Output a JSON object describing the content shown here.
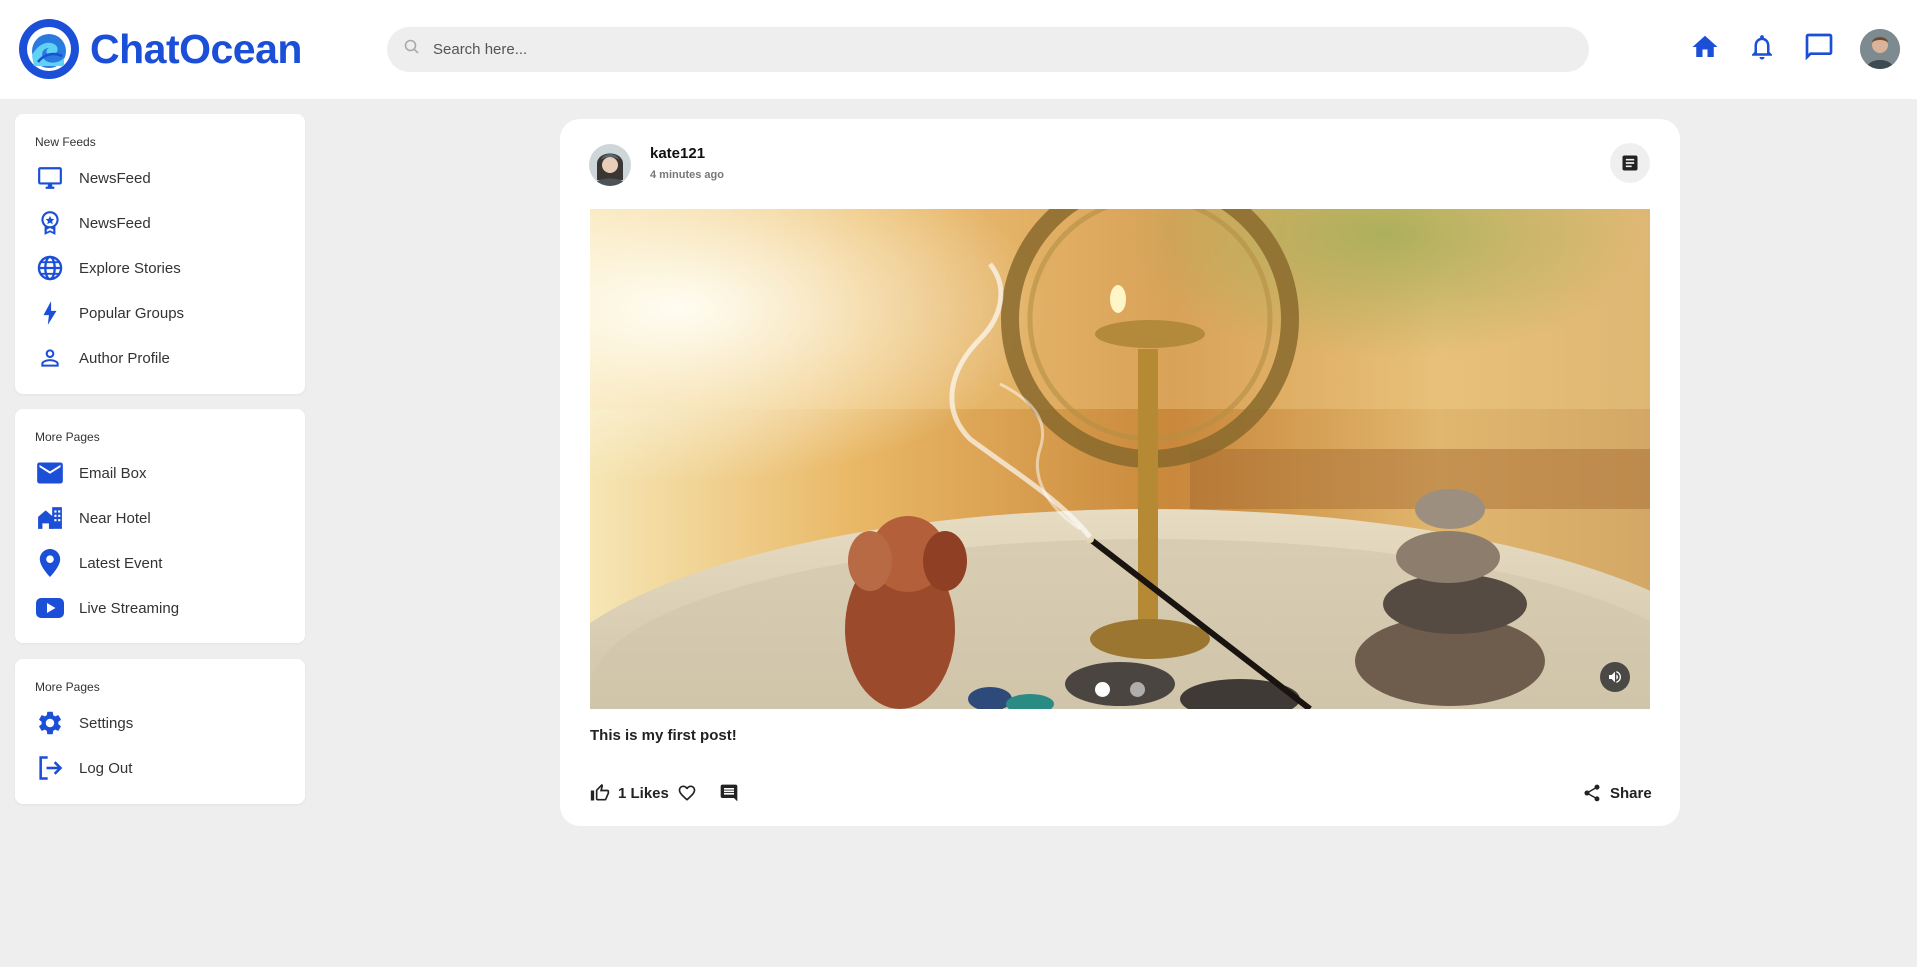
{
  "brand": {
    "name": "ChatOcean",
    "color": "#1b4fd8"
  },
  "search": {
    "placeholder": "Search here..."
  },
  "header_icons": [
    "home-icon",
    "bell-icon",
    "chat-icon"
  ],
  "sidebar": {
    "sections": [
      {
        "title": "New Feeds",
        "items": [
          {
            "label": "NewsFeed",
            "icon": "monitor-icon"
          },
          {
            "label": "NewsFeed",
            "icon": "award-badge-icon"
          },
          {
            "label": "Explore Stories",
            "icon": "globe-icon"
          },
          {
            "label": "Popular Groups",
            "icon": "lightning-icon"
          },
          {
            "label": "Author Profile",
            "icon": "user-icon"
          }
        ]
      },
      {
        "title": "More Pages",
        "items": [
          {
            "label": "Email Box",
            "icon": "mail-icon"
          },
          {
            "label": "Near Hotel",
            "icon": "hotel-icon"
          },
          {
            "label": "Latest Event",
            "icon": "location-pin-icon"
          },
          {
            "label": "Live Streaming",
            "icon": "youtube-icon"
          }
        ]
      },
      {
        "title": "More Pages",
        "items": [
          {
            "label": "Settings",
            "icon": "gear-icon"
          },
          {
            "label": "Log Out",
            "icon": "logout-icon"
          }
        ]
      }
    ]
  },
  "post": {
    "username": "kate121",
    "time": "4 minutes ago",
    "caption": "This is my first post!",
    "likes": "1 Likes",
    "share_label": "Share",
    "carousel": {
      "slides": 2,
      "active": 1
    }
  }
}
